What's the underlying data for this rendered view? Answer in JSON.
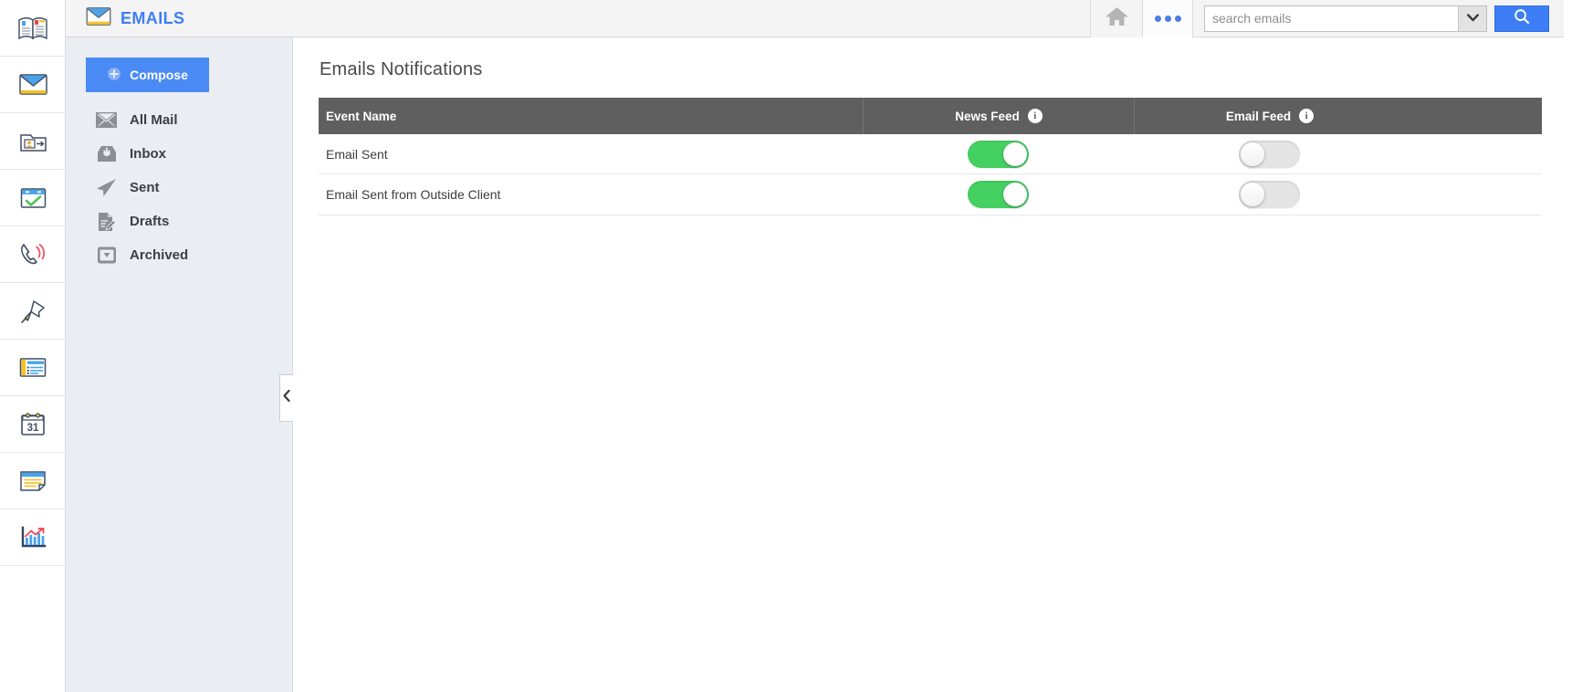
{
  "colors": {
    "brand_blue": "#3d7ef7",
    "compose_blue": "#4a8af4",
    "table_header_gray": "#5f5f5f",
    "toggle_on_green": "#45d062",
    "toggle_off_gray": "#e4e4e4",
    "panel_bg": "#eaedf1"
  },
  "rail": {
    "items": [
      {
        "name": "address-book-icon",
        "label": "Address Book"
      },
      {
        "name": "mail-icon",
        "label": "Emails"
      },
      {
        "name": "contacts-folder-icon",
        "label": "Contacts"
      },
      {
        "name": "tasks-icon",
        "label": "Tasks"
      },
      {
        "name": "phone-calls-icon",
        "label": "Calls"
      },
      {
        "name": "pin-icon",
        "label": "Pinned"
      },
      {
        "name": "news-icon",
        "label": "News"
      },
      {
        "name": "calendar-icon",
        "label": "Calendar"
      },
      {
        "name": "notes-icon",
        "label": "Notes"
      },
      {
        "name": "reports-chart-icon",
        "label": "Reports"
      }
    ]
  },
  "topbar": {
    "app_icon": "mail-icon",
    "title": "EMAILS",
    "home_icon": "home-icon",
    "more_icon": "more-dots-icon",
    "search": {
      "placeholder": "search emails",
      "value": "",
      "caret_icon": "chevron-down-icon",
      "button_icon": "search-icon"
    }
  },
  "navpanel": {
    "compose": {
      "label": "Compose",
      "icon": "plus-circle-icon"
    },
    "items": [
      {
        "label": "All Mail",
        "icon": "envelope-icon"
      },
      {
        "label": "Inbox",
        "icon": "inbox-icon"
      },
      {
        "label": "Sent",
        "icon": "paper-plane-icon"
      },
      {
        "label": "Drafts",
        "icon": "draft-pencil-icon"
      },
      {
        "label": "Archived",
        "icon": "archive-box-icon"
      }
    ],
    "collapse_handle_icon": "chevron-left-icon"
  },
  "main": {
    "page_title": "Emails Notifications",
    "table": {
      "columns": [
        {
          "label": "Event Name",
          "info": false
        },
        {
          "label": "News Feed",
          "info": true,
          "info_icon": "info-icon"
        },
        {
          "label": "Email Feed",
          "info": true,
          "info_icon": "info-icon"
        }
      ],
      "rows": [
        {
          "event": "Email Sent",
          "news_feed": "on",
          "email_feed": "off"
        },
        {
          "event": "Email Sent from Outside Client",
          "news_feed": "on",
          "email_feed": "off"
        }
      ]
    }
  }
}
